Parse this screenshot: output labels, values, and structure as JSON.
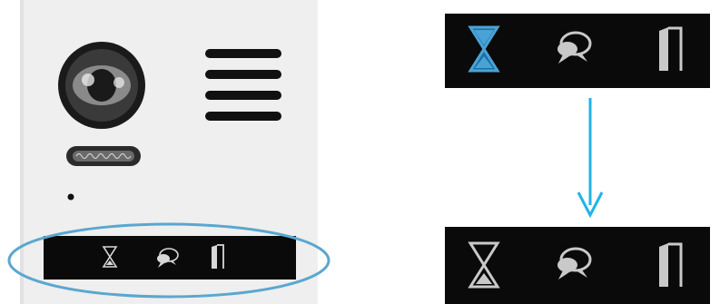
{
  "panel": {
    "description_icons": [
      "hourglass-icon",
      "speech-bubble-icon",
      "door-icon"
    ],
    "states": [
      {
        "name": "active",
        "hourglass_color": "#4aa3d6"
      },
      {
        "name": "idle",
        "hourglass_color": "#c9c9c9"
      }
    ]
  },
  "colors": {
    "device_body": "#efefef",
    "status_bar": "#0a0a0a",
    "highlight_ring": "#5aa7cf",
    "arrow": "#1fb4e6",
    "icon_light": "#d7d7d7"
  }
}
